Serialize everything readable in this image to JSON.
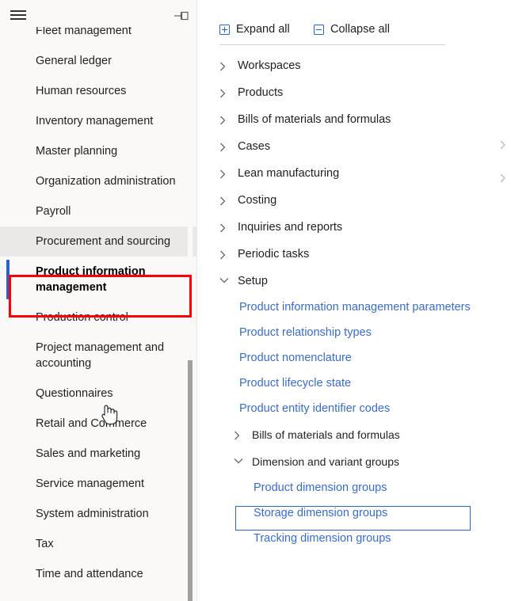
{
  "sidebar": {
    "hamburger_icon": "hamburger-menu-icon",
    "pin_icon": "pin-panel-icon",
    "items": [
      {
        "label": "Fleet management",
        "state": "normal"
      },
      {
        "label": "General ledger",
        "state": "normal"
      },
      {
        "label": "Human resources",
        "state": "normal"
      },
      {
        "label": "Inventory management",
        "state": "normal"
      },
      {
        "label": "Master planning",
        "state": "normal"
      },
      {
        "label": "Organization administration",
        "state": "normal"
      },
      {
        "label": "Payroll",
        "state": "normal"
      },
      {
        "label": "Procurement and sourcing",
        "state": "hovered"
      },
      {
        "label": "Product information management",
        "state": "selected"
      },
      {
        "label": "Production control",
        "state": "normal"
      },
      {
        "label": "Project management and accounting",
        "state": "normal"
      },
      {
        "label": "Questionnaires",
        "state": "normal"
      },
      {
        "label": "Retail and Commerce",
        "state": "normal"
      },
      {
        "label": "Sales and marketing",
        "state": "normal"
      },
      {
        "label": "Service management",
        "state": "normal"
      },
      {
        "label": "System administration",
        "state": "normal"
      },
      {
        "label": "Tax",
        "state": "normal"
      },
      {
        "label": "Time and attendance",
        "state": "normal"
      }
    ]
  },
  "panel": {
    "toolbar": {
      "expand_all_label": "Expand all",
      "collapse_all_label": "Collapse all",
      "expand_icon": "plus-box-icon",
      "collapse_icon": "minus-box-icon"
    },
    "tree": [
      {
        "label": "Workspaces",
        "type": "group",
        "expanded": false
      },
      {
        "label": "Products",
        "type": "group",
        "expanded": false
      },
      {
        "label": "Bills of materials and formulas",
        "type": "group",
        "expanded": false
      },
      {
        "label": "Cases",
        "type": "group",
        "expanded": false
      },
      {
        "label": "Lean manufacturing",
        "type": "group",
        "expanded": false
      },
      {
        "label": "Costing",
        "type": "group",
        "expanded": false
      },
      {
        "label": "Inquiries and reports",
        "type": "group",
        "expanded": false
      },
      {
        "label": "Periodic tasks",
        "type": "group",
        "expanded": false
      },
      {
        "label": "Setup",
        "type": "group",
        "expanded": true
      },
      {
        "label": "Product information management parameters",
        "type": "link"
      },
      {
        "label": "Product relationship types",
        "type": "link"
      },
      {
        "label": "Product nomenclature",
        "type": "link"
      },
      {
        "label": "Product lifecycle state",
        "type": "link"
      },
      {
        "label": "Product entity identifier codes",
        "type": "link"
      },
      {
        "label": "Bills of materials and formulas",
        "type": "subgroup",
        "expanded": false
      },
      {
        "label": "Dimension and variant groups",
        "type": "subgroup",
        "expanded": true,
        "focused": true
      },
      {
        "label": "Product dimension groups",
        "type": "sublink"
      },
      {
        "label": "Storage dimension groups",
        "type": "sublink"
      },
      {
        "label": "Tracking dimension groups",
        "type": "sublink"
      }
    ]
  },
  "colors": {
    "link_blue": "#3b6cc4",
    "accent_blue": "#2566c6",
    "annotation_red": "#fb0007",
    "selected_bar": "#2b62c4",
    "sidebar_bg": "#faf9f8",
    "hover_bg": "#ebe9e7",
    "text": "#201f1e"
  }
}
